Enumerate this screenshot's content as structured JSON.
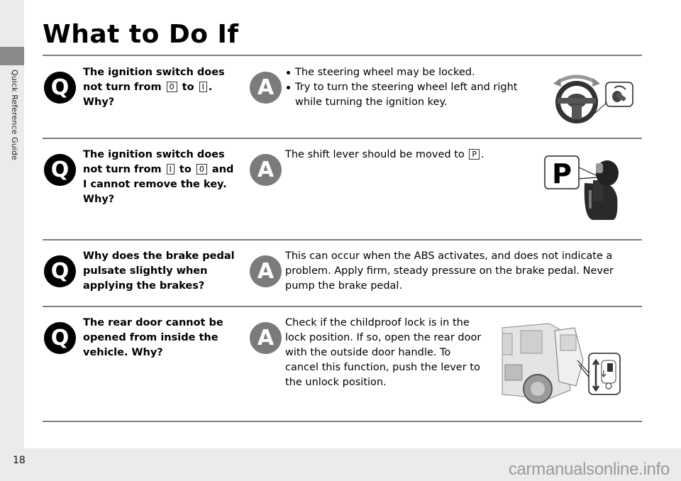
{
  "sidebar": {
    "section_label": "Quick Reference Guide"
  },
  "header": {
    "title": "What to Do If"
  },
  "qa_items": [
    {
      "question_parts": [
        "The ignition switch does not turn from ",
        "0",
        " to ",
        "I",
        ". Why?"
      ],
      "answer_type": "bullets",
      "answer_bullets": [
        "The steering wheel may be locked.",
        "Try to turn the steering wheel left and right while turning the ignition key."
      ],
      "illustration": "steering-wheel-illustration"
    },
    {
      "question_parts": [
        "The ignition switch does not turn from ",
        "I",
        " to ",
        "0",
        " and I cannot remove the key. Why?"
      ],
      "answer_type": "text",
      "answer_parts": [
        "The shift lever should be moved to ",
        "P",
        "."
      ],
      "illustration": "shift-lever-illustration",
      "illustration_label": "P"
    },
    {
      "question": "Why does the brake pedal pulsate slightly when applying the brakes?",
      "answer_type": "text",
      "answer": "This can occur when the ABS activates, and does not indicate a problem. Apply firm, steady pressure on the brake pedal. Never pump the brake pedal."
    },
    {
      "question": "The rear door cannot be opened from inside the vehicle. Why?",
      "answer_type": "text",
      "answer": "Check if the childproof lock is in the lock position. If so, open the rear door with the outside door handle. To cancel this function, push the lever to the unlock position.",
      "illustration": "childproof-lock-illustration"
    }
  ],
  "icons": {
    "question_badge": "Q",
    "answer_badge": "A"
  },
  "footer": {
    "page_number": "18",
    "watermark": "carmanualsonline.info"
  },
  "colors": {
    "question_badge": "#000000",
    "answer_badge": "#7b7b7b",
    "rule": "#7c7c7c",
    "side_tab": "#8a8a8a",
    "background": "#ebebeb"
  }
}
